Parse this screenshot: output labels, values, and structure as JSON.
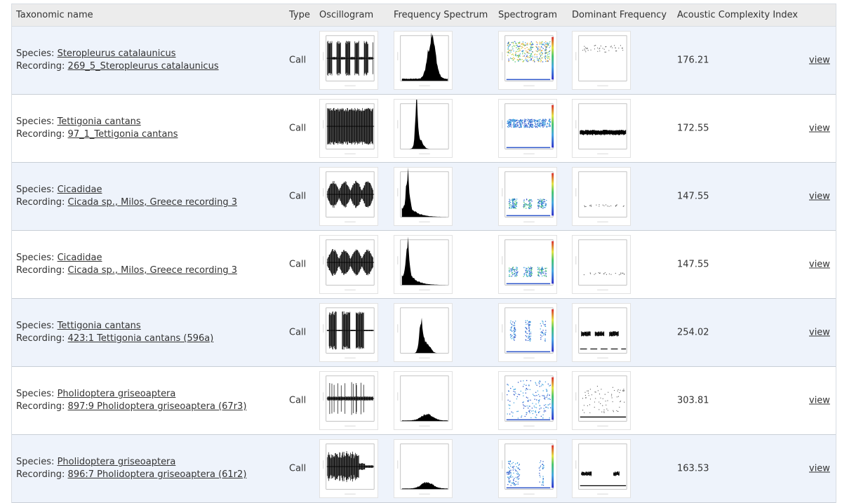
{
  "headers": {
    "taxonomic_name": "Taxonomic name",
    "type": "Type",
    "oscillogram": "Oscillogram",
    "frequency_spectrum": "Frequency Spectrum",
    "spectrogram": "Spectrogram",
    "dominant_frequency": "Dominant Frequency",
    "aci": "Acoustic Complexity Index"
  },
  "labels": {
    "species": "Species:",
    "recording": "Recording:"
  },
  "rows": [
    {
      "species": "Steropleurus catalaunicus",
      "recording": "269_5_Steropleurus catalaunicus",
      "type": "Call",
      "aci": "176.21",
      "view": "view"
    },
    {
      "species": "Tettigonia cantans",
      "recording": "97_1_Tettigonia cantans",
      "type": "Call",
      "aci": "172.55",
      "view": "view"
    },
    {
      "species": "Cicadidae",
      "recording": "Cicada sp., Milos, Greece recording 3",
      "type": "Call",
      "aci": "147.55",
      "view": "view"
    },
    {
      "species": "Cicadidae",
      "recording": "Cicada sp., Milos, Greece recording 3",
      "type": "Call",
      "aci": "147.55",
      "view": "view"
    },
    {
      "species": "Tettigonia cantans",
      "recording": "423:1 Tettigonia cantans (596a)",
      "type": "Call",
      "aci": "254.02",
      "view": "view"
    },
    {
      "species": "Pholidoptera griseoaptera",
      "recording": "897:9 Pholidoptera griseoaptera (67r3)",
      "type": "Call",
      "aci": "303.81",
      "view": "view"
    },
    {
      "species": "Pholidoptera griseoaptera",
      "recording": "896:7 Pholidoptera griseoaptera (61r2)",
      "type": "Call",
      "aci": "163.53",
      "view": "view"
    }
  ],
  "thumbnail_icons": [
    "oscillogram-plot",
    "frequency-spectrum-plot",
    "spectrogram-plot",
    "dominant-frequency-plot"
  ]
}
